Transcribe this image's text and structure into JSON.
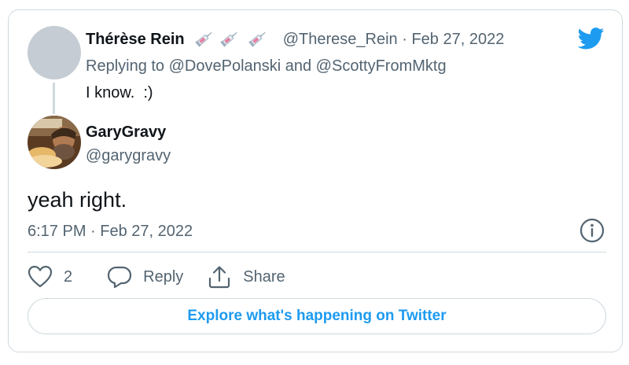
{
  "parent_tweet": {
    "display_name": "Thérèse Rein",
    "handle": "@Therese_Rein",
    "separator": "·",
    "date": "Feb 27, 2022",
    "replying_to": "Replying to @DovePolanski and @ScottyFromMktg",
    "text": "I know.  :)",
    "name_emoji": [
      "syringe",
      "syringe",
      "syringe"
    ]
  },
  "main_tweet": {
    "display_name": "GaryGravy",
    "handle": "@garygravy",
    "text": "yeah right.",
    "timestamp": "6:17 PM · Feb 27, 2022"
  },
  "actions": {
    "like_count": "2",
    "reply_label": "Reply",
    "share_label": "Share"
  },
  "cta": {
    "explore_label": "Explore what's happening on Twitter"
  },
  "icons": {
    "brand": "twitter-bird-icon",
    "info": "info-icon",
    "like": "heart-icon",
    "reply": "reply-bubble-icon",
    "share": "share-icon"
  },
  "colors": {
    "brand": "#1d9bf0",
    "text_primary": "#0f1419",
    "text_secondary": "#536471",
    "border": "#cfd9de"
  }
}
